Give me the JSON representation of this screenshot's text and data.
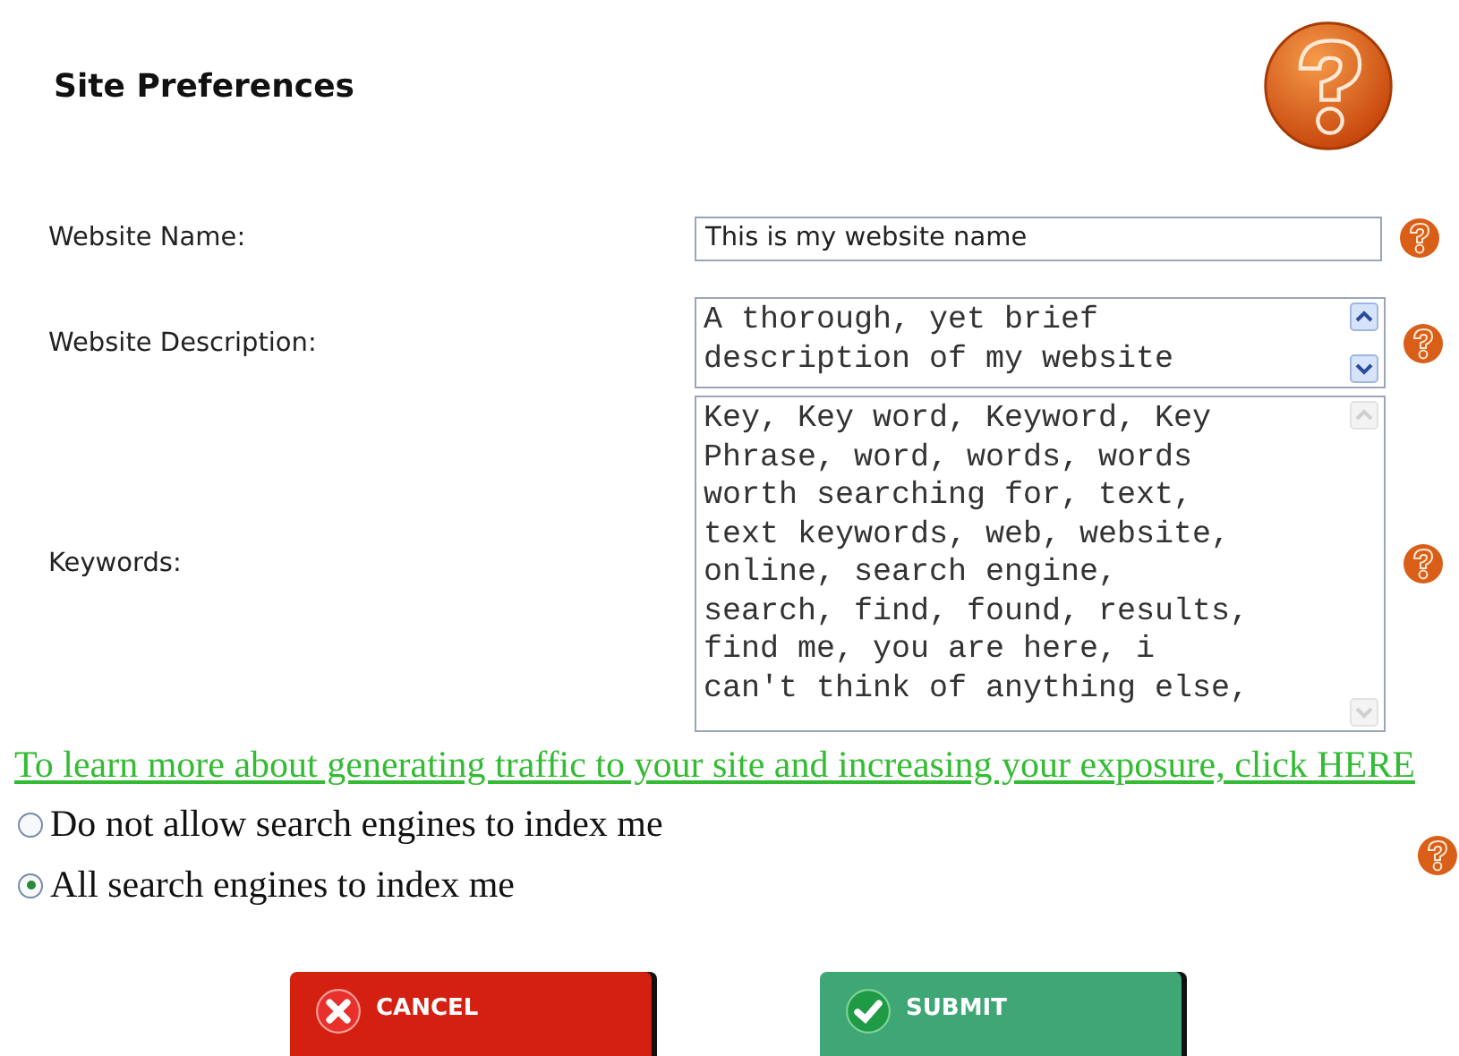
{
  "title": "Site Preferences",
  "fields": [
    {
      "kind": "input",
      "label": "Website Name:",
      "value": "This is my website name"
    },
    {
      "kind": "textarea",
      "label": "Website Description:",
      "value": "A thorough, yet brief\ndescription of my website",
      "scroll_active": true
    },
    {
      "kind": "textarea",
      "label": "Keywords:",
      "value": "Key, Key word, Keyword, Key\nPhrase, word, words, words\nworth searching for, text,\ntext keywords, web, website,\nonline, search engine,\nsearch, find, found, results,\nfind me, you are here, i\ncan't think of anything else,",
      "scroll_active": false
    }
  ],
  "link": "To learn more about generating traffic to your site and increasing your exposure, click HERE",
  "indexing": [
    {
      "label": "Do not allow search engines to index me",
      "selected": false
    },
    {
      "label": "All search engines to index me",
      "selected": true
    }
  ],
  "buttons": [
    {
      "kind": "cancel",
      "label": "CANCEL"
    },
    {
      "kind": "submit",
      "label": "SUBMIT"
    }
  ]
}
